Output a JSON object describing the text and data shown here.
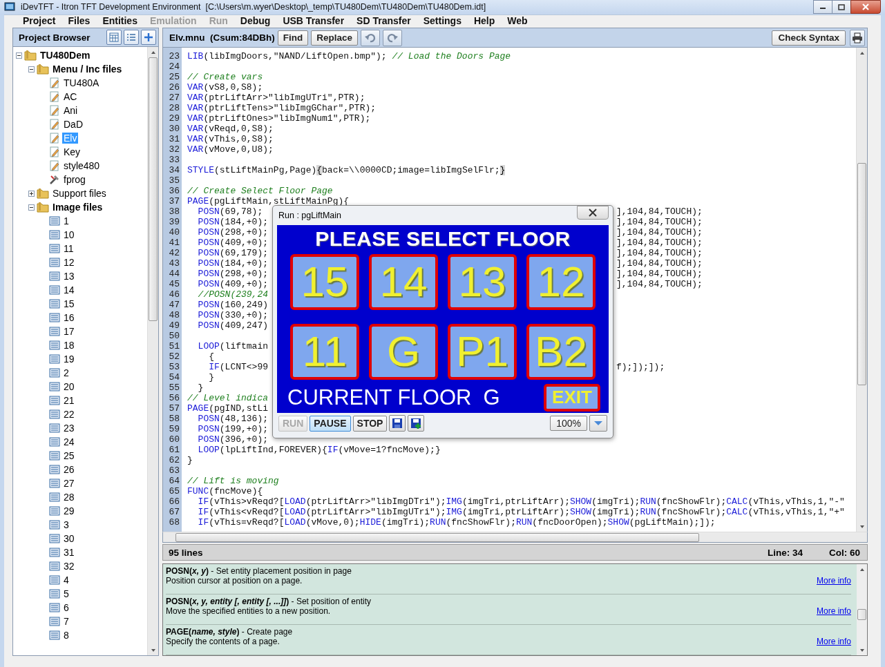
{
  "window": {
    "title": "iDevTFT - Itron TFT Development Environment  [C:\\Users\\m.wyer\\Desktop\\_temp\\TU480Dem\\TU480Dem\\TU480Dem.idt]"
  },
  "menu": [
    {
      "label": "Project",
      "disabled": false
    },
    {
      "label": "Files",
      "disabled": false
    },
    {
      "label": "Entities",
      "disabled": false
    },
    {
      "label": "Emulation",
      "disabled": true
    },
    {
      "label": "Run",
      "disabled": true
    },
    {
      "label": "Debug",
      "disabled": false
    },
    {
      "label": "USB Transfer",
      "disabled": false
    },
    {
      "label": "SD Transfer",
      "disabled": false
    },
    {
      "label": "Settings",
      "disabled": false
    },
    {
      "label": "Help",
      "disabled": false
    },
    {
      "label": "Web",
      "disabled": false
    }
  ],
  "sidebar": {
    "title": "Project Browser",
    "tree": [
      {
        "label": "TU480Dem",
        "kind": "folder",
        "expanded": true,
        "selected": false,
        "children": [
          {
            "label": "Menu / Inc files",
            "kind": "folder",
            "expanded": true,
            "selected": false,
            "children": [
              {
                "label": "TU480A",
                "kind": "script",
                "selected": false
              },
              {
                "label": "AC",
                "kind": "script",
                "selected": false
              },
              {
                "label": "Ani",
                "kind": "script",
                "selected": false
              },
              {
                "label": "DaD",
                "kind": "script",
                "selected": false
              },
              {
                "label": "Elv",
                "kind": "script",
                "selected": true
              },
              {
                "label": "Key",
                "kind": "script",
                "selected": false
              },
              {
                "label": "style480",
                "kind": "script",
                "selected": false
              },
              {
                "label": "fprog",
                "kind": "program",
                "selected": false
              }
            ]
          },
          {
            "label": "Support files",
            "kind": "folder",
            "expanded": false,
            "selected": false
          },
          {
            "label": "Image files",
            "kind": "folder",
            "expanded": true,
            "selected": false,
            "children": [
              {
                "label": "1",
                "kind": "image",
                "selected": false
              },
              {
                "label": "10",
                "kind": "image",
                "selected": false
              },
              {
                "label": "11",
                "kind": "image",
                "selected": false
              },
              {
                "label": "12",
                "kind": "image",
                "selected": false
              },
              {
                "label": "13",
                "kind": "image",
                "selected": false
              },
              {
                "label": "14",
                "kind": "image",
                "selected": false
              },
              {
                "label": "15",
                "kind": "image",
                "selected": false
              },
              {
                "label": "16",
                "kind": "image",
                "selected": false
              },
              {
                "label": "17",
                "kind": "image",
                "selected": false
              },
              {
                "label": "18",
                "kind": "image",
                "selected": false
              },
              {
                "label": "19",
                "kind": "image",
                "selected": false
              },
              {
                "label": "2",
                "kind": "image",
                "selected": false
              },
              {
                "label": "20",
                "kind": "image",
                "selected": false
              },
              {
                "label": "21",
                "kind": "image",
                "selected": false
              },
              {
                "label": "22",
                "kind": "image",
                "selected": false
              },
              {
                "label": "23",
                "kind": "image",
                "selected": false
              },
              {
                "label": "24",
                "kind": "image",
                "selected": false
              },
              {
                "label": "25",
                "kind": "image",
                "selected": false
              },
              {
                "label": "26",
                "kind": "image",
                "selected": false
              },
              {
                "label": "27",
                "kind": "image",
                "selected": false
              },
              {
                "label": "28",
                "kind": "image",
                "selected": false
              },
              {
                "label": "29",
                "kind": "image",
                "selected": false
              },
              {
                "label": "3",
                "kind": "image",
                "selected": false
              },
              {
                "label": "30",
                "kind": "image",
                "selected": false
              },
              {
                "label": "31",
                "kind": "image",
                "selected": false
              },
              {
                "label": "32",
                "kind": "image",
                "selected": false
              },
              {
                "label": "4",
                "kind": "image",
                "selected": false
              },
              {
                "label": "5",
                "kind": "image",
                "selected": false
              },
              {
                "label": "6",
                "kind": "image",
                "selected": false
              },
              {
                "label": "7",
                "kind": "image",
                "selected": false
              },
              {
                "label": "8",
                "kind": "image",
                "selected": false
              }
            ]
          }
        ]
      }
    ]
  },
  "editor": {
    "file": "Elv.mnu  (Csum:84DBh)",
    "buttons": [
      "Find",
      "Replace"
    ],
    "check_button": "Check Syntax",
    "lines": [
      {
        "num": "23",
        "parts": [
          {
            "kind": "keyword",
            "text": "LIB"
          },
          {
            "kind": "plain",
            "text": "(libImgDoors,\"NAND/LiftOpen.bmp\"); "
          },
          {
            "kind": "comment",
            "text": "// Load the Doors Page"
          }
        ]
      },
      {
        "num": "24"
      },
      {
        "num": "25",
        "parts": [
          {
            "kind": "comment",
            "text": "// Create vars"
          }
        ]
      },
      {
        "num": "26",
        "parts": [
          {
            "kind": "keyword",
            "text": "VAR"
          },
          {
            "kind": "plain",
            "text": "(vS8,0,S8);"
          }
        ]
      },
      {
        "num": "27",
        "parts": [
          {
            "kind": "keyword",
            "text": "VAR"
          },
          {
            "kind": "plain",
            "text": "(ptrLiftArr>\"libImgUTri\",PTR);"
          }
        ]
      },
      {
        "num": "28",
        "parts": [
          {
            "kind": "keyword",
            "text": "VAR"
          },
          {
            "kind": "plain",
            "text": "(ptrLiftTens>\"libImgGChar\",PTR);"
          }
        ]
      },
      {
        "num": "29",
        "parts": [
          {
            "kind": "keyword",
            "text": "VAR"
          },
          {
            "kind": "plain",
            "text": "(ptrLiftOnes>\"libImgNum1\",PTR);"
          }
        ]
      },
      {
        "num": "30",
        "parts": [
          {
            "kind": "keyword",
            "text": "VAR"
          },
          {
            "kind": "plain",
            "text": "(vReqd,0,S8);"
          }
        ]
      },
      {
        "num": "31",
        "parts": [
          {
            "kind": "keyword",
            "text": "VAR"
          },
          {
            "kind": "plain",
            "text": "(vThis,0,S8);"
          }
        ]
      },
      {
        "num": "32",
        "parts": [
          {
            "kind": "keyword",
            "text": "VAR"
          },
          {
            "kind": "plain",
            "text": "(vMove,0,U8);"
          }
        ]
      },
      {
        "num": "33"
      },
      {
        "num": "34",
        "parts": [
          {
            "kind": "keyword",
            "text": "STYLE"
          },
          {
            "kind": "plain",
            "text": "(stLiftMainPg,Page)"
          },
          {
            "kind": "matched",
            "text": "{"
          },
          {
            "kind": "plain",
            "text": "back=\\\\0000CD;image=libImgSelFlr;"
          },
          {
            "kind": "matched",
            "text": "}"
          }
        ]
      },
      {
        "num": "35"
      },
      {
        "num": "36",
        "parts": [
          {
            "kind": "comment",
            "text": "// Create Select Floor Page"
          }
        ]
      },
      {
        "num": "37",
        "parts": [
          {
            "kind": "keyword",
            "text": "PAGE"
          },
          {
            "kind": "plain",
            "text": "(pgLiftMain,stLiftMainPg){"
          }
        ]
      },
      {
        "num": "38",
        "parts": [
          {
            "kind": "keyword",
            "text": "  POSN"
          },
          {
            "kind": "plain",
            "text": "(69,78);"
          }
        ],
        "right": [
          {
            "kind": "plain",
            "text": "],104,84,TOUCH);"
          }
        ]
      },
      {
        "num": "39",
        "parts": [
          {
            "kind": "keyword",
            "text": "  POSN"
          },
          {
            "kind": "plain",
            "text": "(184,+0);"
          }
        ],
        "right": [
          {
            "kind": "plain",
            "text": "],104,84,TOUCH);"
          }
        ]
      },
      {
        "num": "40",
        "parts": [
          {
            "kind": "keyword",
            "text": "  POSN"
          },
          {
            "kind": "plain",
            "text": "(298,+0);"
          }
        ],
        "right": [
          {
            "kind": "plain",
            "text": "],104,84,TOUCH);"
          }
        ]
      },
      {
        "num": "41",
        "parts": [
          {
            "kind": "keyword",
            "text": "  POSN"
          },
          {
            "kind": "plain",
            "text": "(409,+0);"
          }
        ],
        "right": [
          {
            "kind": "plain",
            "text": "],104,84,TOUCH);"
          }
        ]
      },
      {
        "num": "42",
        "parts": [
          {
            "kind": "keyword",
            "text": "  POSN"
          },
          {
            "kind": "plain",
            "text": "(69,179);"
          }
        ],
        "right": [
          {
            "kind": "plain",
            "text": "],104,84,TOUCH);"
          }
        ]
      },
      {
        "num": "43",
        "parts": [
          {
            "kind": "keyword",
            "text": "  POSN"
          },
          {
            "kind": "plain",
            "text": "(184,+0);"
          }
        ],
        "right": [
          {
            "kind": "plain",
            "text": "],104,84,TOUCH);"
          }
        ]
      },
      {
        "num": "44",
        "parts": [
          {
            "kind": "keyword",
            "text": "  POSN"
          },
          {
            "kind": "plain",
            "text": "(298,+0);"
          }
        ],
        "right": [
          {
            "kind": "plain",
            "text": "],104,84,TOUCH);"
          }
        ]
      },
      {
        "num": "45",
        "parts": [
          {
            "kind": "keyword",
            "text": "  POSN"
          },
          {
            "kind": "plain",
            "text": "(409,+0);"
          }
        ],
        "right": [
          {
            "kind": "plain",
            "text": "],104,84,TOUCH);"
          }
        ]
      },
      {
        "num": "46",
        "parts": [
          {
            "kind": "comment",
            "text": "  //POSN(239,24"
          }
        ]
      },
      {
        "num": "47",
        "parts": [
          {
            "kind": "keyword",
            "text": "  POSN"
          },
          {
            "kind": "plain",
            "text": "(160,249)"
          }
        ]
      },
      {
        "num": "48",
        "parts": [
          {
            "kind": "keyword",
            "text": "  POSN"
          },
          {
            "kind": "plain",
            "text": "(330,+0);"
          }
        ]
      },
      {
        "num": "49",
        "parts": [
          {
            "kind": "keyword",
            "text": "  POSN"
          },
          {
            "kind": "plain",
            "text": "(409,247)"
          }
        ]
      },
      {
        "num": "50"
      },
      {
        "num": "51",
        "parts": [
          {
            "kind": "keyword",
            "text": "  LOOP"
          },
          {
            "kind": "plain",
            "text": "(liftmain"
          }
        ]
      },
      {
        "num": "52",
        "parts": [
          {
            "kind": "plain",
            "text": "    {"
          }
        ]
      },
      {
        "num": "53",
        "parts": [
          {
            "kind": "keyword",
            "text": "    IF"
          },
          {
            "kind": "plain",
            "text": "(LCNT<>99"
          }
        ],
        "right": [
          {
            "kind": "plain",
            "text": "f);]);]);"
          }
        ]
      },
      {
        "num": "54",
        "parts": [
          {
            "kind": "plain",
            "text": "    }"
          }
        ]
      },
      {
        "num": "55",
        "parts": [
          {
            "kind": "plain",
            "text": "  }"
          }
        ]
      },
      {
        "num": "56",
        "parts": [
          {
            "kind": "comment",
            "text": "// Level indica"
          }
        ]
      },
      {
        "num": "57",
        "parts": [
          {
            "kind": "keyword",
            "text": "PAGE"
          },
          {
            "kind": "plain",
            "text": "(pgIND,stLi"
          }
        ]
      },
      {
        "num": "58",
        "parts": [
          {
            "kind": "keyword",
            "text": "  POSN"
          },
          {
            "kind": "plain",
            "text": "(48,136);"
          }
        ]
      },
      {
        "num": "59",
        "parts": [
          {
            "kind": "keyword",
            "text": "  POSN"
          },
          {
            "kind": "plain",
            "text": "(199,+0);"
          }
        ]
      },
      {
        "num": "60",
        "parts": [
          {
            "kind": "keyword",
            "text": "  POSN"
          },
          {
            "kind": "plain",
            "text": "(396,+0);"
          }
        ]
      },
      {
        "num": "61",
        "parts": [
          {
            "kind": "keyword",
            "text": "  LOOP"
          },
          {
            "kind": "plain",
            "text": "(lpLiftInd,FOREVER){"
          },
          {
            "kind": "keyword",
            "text": "IF"
          },
          {
            "kind": "plain",
            "text": "(vMove=1?fncMove);}"
          }
        ]
      },
      {
        "num": "62",
        "parts": [
          {
            "kind": "plain",
            "text": "}"
          }
        ]
      },
      {
        "num": "63"
      },
      {
        "num": "64",
        "parts": [
          {
            "kind": "comment",
            "text": "// Lift is moving"
          }
        ]
      },
      {
        "num": "65",
        "parts": [
          {
            "kind": "keyword",
            "text": "FUNC"
          },
          {
            "kind": "plain",
            "text": "(fncMove){"
          }
        ]
      },
      {
        "num": "66",
        "parts": [
          {
            "kind": "keyword",
            "text": "  IF"
          },
          {
            "kind": "plain",
            "text": "(vThis>vReqd?["
          },
          {
            "kind": "keyword",
            "text": "LOAD"
          },
          {
            "kind": "plain",
            "text": "(ptrLiftArr>\"libImgDTri\");"
          },
          {
            "kind": "keyword",
            "text": "IMG"
          },
          {
            "kind": "plain",
            "text": "(imgTri,ptrLiftArr);"
          },
          {
            "kind": "keyword",
            "text": "SHOW"
          },
          {
            "kind": "plain",
            "text": "(imgTri);"
          },
          {
            "kind": "keyword",
            "text": "RUN"
          },
          {
            "kind": "plain",
            "text": "(fncShowFlr);"
          },
          {
            "kind": "keyword",
            "text": "CALC"
          },
          {
            "kind": "plain",
            "text": "(vThis,vThis,1,\"-\""
          }
        ]
      },
      {
        "num": "67",
        "parts": [
          {
            "kind": "keyword",
            "text": "  IF"
          },
          {
            "kind": "plain",
            "text": "(vThis<vReqd?["
          },
          {
            "kind": "keyword",
            "text": "LOAD"
          },
          {
            "kind": "plain",
            "text": "(ptrLiftArr>\"libImgUTri\");"
          },
          {
            "kind": "keyword",
            "text": "IMG"
          },
          {
            "kind": "plain",
            "text": "(imgTri,ptrLiftArr);"
          },
          {
            "kind": "keyword",
            "text": "SHOW"
          },
          {
            "kind": "plain",
            "text": "(imgTri);"
          },
          {
            "kind": "keyword",
            "text": "RUN"
          },
          {
            "kind": "plain",
            "text": "(fncShowFlr);"
          },
          {
            "kind": "keyword",
            "text": "CALC"
          },
          {
            "kind": "plain",
            "text": "(vThis,vThis,1,\"+\""
          }
        ]
      },
      {
        "num": "68",
        "parts": [
          {
            "kind": "keyword",
            "text": "  IF"
          },
          {
            "kind": "plain",
            "text": "(vThis=vReqd?["
          },
          {
            "kind": "keyword",
            "text": "LOAD"
          },
          {
            "kind": "plain",
            "text": "(vMove,0);"
          },
          {
            "kind": "keyword",
            "text": "HIDE"
          },
          {
            "kind": "plain",
            "text": "(imgTri);"
          },
          {
            "kind": "keyword",
            "text": "RUN"
          },
          {
            "kind": "plain",
            "text": "(fncShowFlr);"
          },
          {
            "kind": "keyword",
            "text": "RUN"
          },
          {
            "kind": "plain",
            "text": "(fncDoorOpen);"
          },
          {
            "kind": "keyword",
            "text": "SHOW"
          },
          {
            "kind": "plain",
            "text": "(pgLiftMain);]);"
          }
        ]
      }
    ]
  },
  "run_window": {
    "title": "Run : pgLiftMain",
    "heading": "PLEASE SELECT FLOOR",
    "floors": [
      "15",
      "14",
      "13",
      "12",
      "11",
      "G",
      "P1",
      "B2"
    ],
    "current_floor": "CURRENT FLOOR  G",
    "exit": "EXIT",
    "controls": [
      {
        "label": "RUN",
        "disabled": true,
        "selected": false
      },
      {
        "label": "PAUSE",
        "disabled": false,
        "selected": true
      },
      {
        "label": "STOP",
        "disabled": false,
        "selected": false
      }
    ],
    "zoom": "100%"
  },
  "status_bar": {
    "lines": "95 lines",
    "line": "Line: 34",
    "col": "Col: 60"
  },
  "help": [
    {
      "name": "POSN(",
      "args": "x, y",
      "close": ")",
      "summary": " - Set entity placement position in page",
      "description": "Position cursor at position on a page.",
      "link": "More info"
    },
    {
      "name": "POSN(",
      "args": "x, y, entity [, entity [, ...]]",
      "close": ")",
      "summary": " - Set position of entity",
      "description": "Move the specified entities to a new position.",
      "link": "More info"
    },
    {
      "name": "PAGE(",
      "args": "name, style",
      "close": ")",
      "summary": " - Create page",
      "description": "Specify the contents of a page.",
      "link": "More info"
    }
  ]
}
